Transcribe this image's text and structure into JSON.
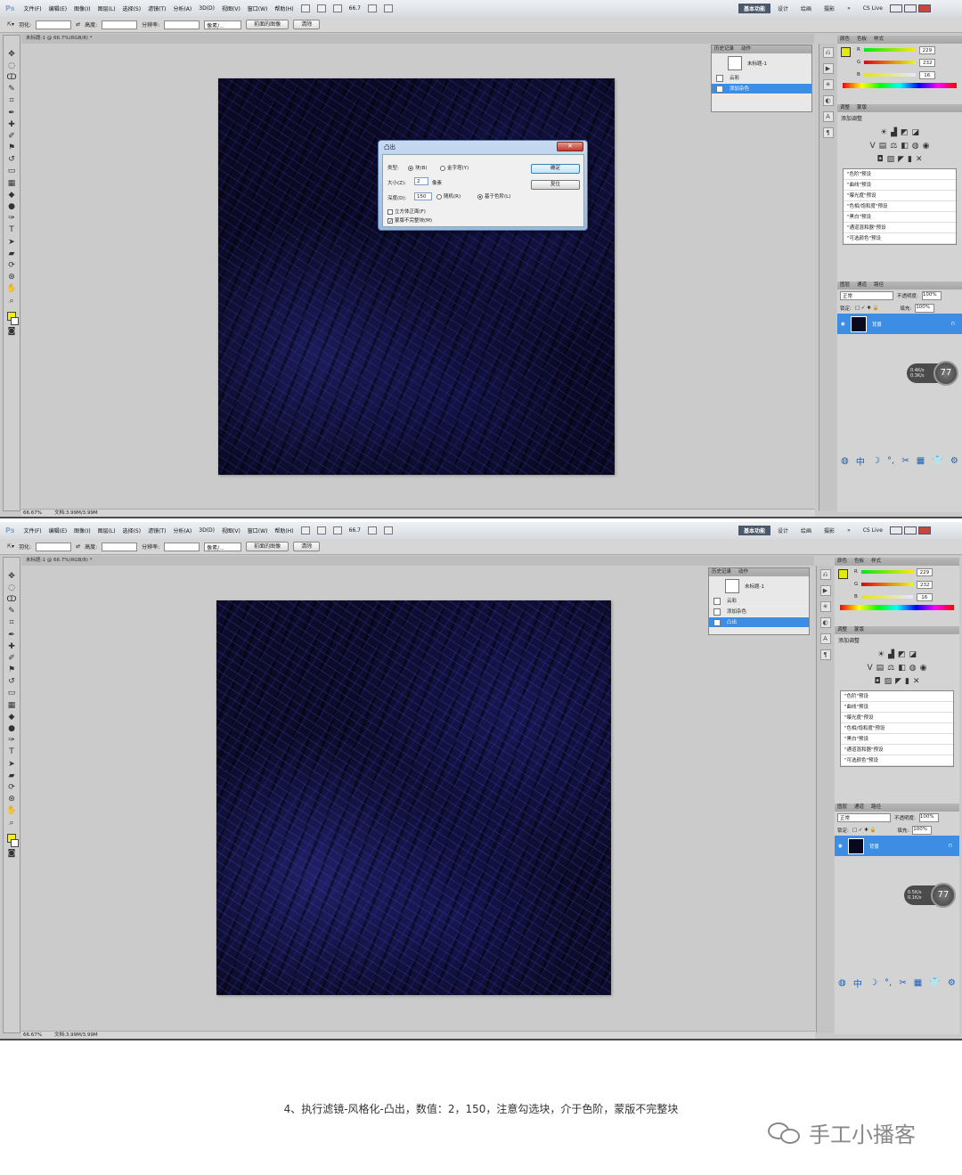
{
  "menu": {
    "app_logo": "Ps",
    "items": [
      "文件(F)",
      "编辑(E)",
      "图像(I)",
      "图层(L)",
      "选择(S)",
      "滤镜(T)",
      "分析(A)",
      "3D(D)",
      "视图(V)",
      "窗口(W)",
      "帮助(H)"
    ],
    "zoom": "66.7",
    "workspaces": [
      "基本功能",
      "设计",
      "绘画",
      "摄影"
    ],
    "more": "»",
    "cslive": "CS Live"
  },
  "options": {
    "feather_label": "羽化:",
    "feather_value": "",
    "width_label": "宽度:",
    "height_label": "高度:",
    "resolution_label": "分辨率:",
    "unit": "像素/...",
    "front_image_btn": "前面的图像",
    "clear_btn": "清除"
  },
  "doc_tab": "未标题-1 @ 66.7%(RGB/8) *",
  "status": {
    "zoom": "66.67%",
    "doc": "文档:3.99M/3.99M"
  },
  "dialog": {
    "title": "凸出",
    "type_label": "类型:",
    "block": "块(B)",
    "pyramid": "金字塔(Y)",
    "size_label": "大小(Z):",
    "size_value": "2",
    "size_unit": "像素",
    "depth_label": "深度(D):",
    "depth_value": "150",
    "random": "随机(R)",
    "level_based": "基于色阶(L)",
    "solid_front": "立方体正面(F)",
    "mask_incomplete": "蒙版不完整块(M)",
    "ok": "确定",
    "reset": "复位"
  },
  "history": {
    "tabs": [
      "历史记录",
      "动作"
    ],
    "snapshot": "未标题-1",
    "items_top": [
      "云彩",
      "添加杂色"
    ],
    "items_bottom": [
      "云彩",
      "添加杂色",
      "凸出"
    ]
  },
  "color_panel": {
    "tabs": [
      "颜色",
      "色板",
      "样式"
    ],
    "r_label": "R",
    "g_label": "G",
    "b_label": "B",
    "r": "229",
    "g": "232",
    "b": "16",
    "fg_color": "#e5e810"
  },
  "adjustments": {
    "tabs": [
      "调整",
      "蒙版"
    ],
    "title": "添加调整",
    "presets": [
      "\"色阶\"预设",
      "\"曲线\"预设",
      "\"曝光度\"预设",
      "\"色相/饱和度\"预设",
      "\"黑白\"预设",
      "\"通道混和器\"预设",
      "\"可选颜色\"预设"
    ]
  },
  "layers": {
    "tabs": [
      "图层",
      "通道",
      "路径"
    ],
    "blend": "正常",
    "opacity_label": "不透明度:",
    "opacity": "100%",
    "lock_label": "锁定:",
    "fill_label": "填充:",
    "fill": "100%",
    "layer_name": "背景"
  },
  "perf_top": {
    "up": "0.4K/s",
    "down": "0.3K/s",
    "pct": "77"
  },
  "perf_bottom": {
    "up": "0.5K/s",
    "down": "0.1K/s",
    "pct": "77"
  },
  "caption": "4、执行滤镜-风格化-凸出，数值：2，150，注意勾选块，介于色阶，蒙版不完整块",
  "watermark": "手工小播客"
}
